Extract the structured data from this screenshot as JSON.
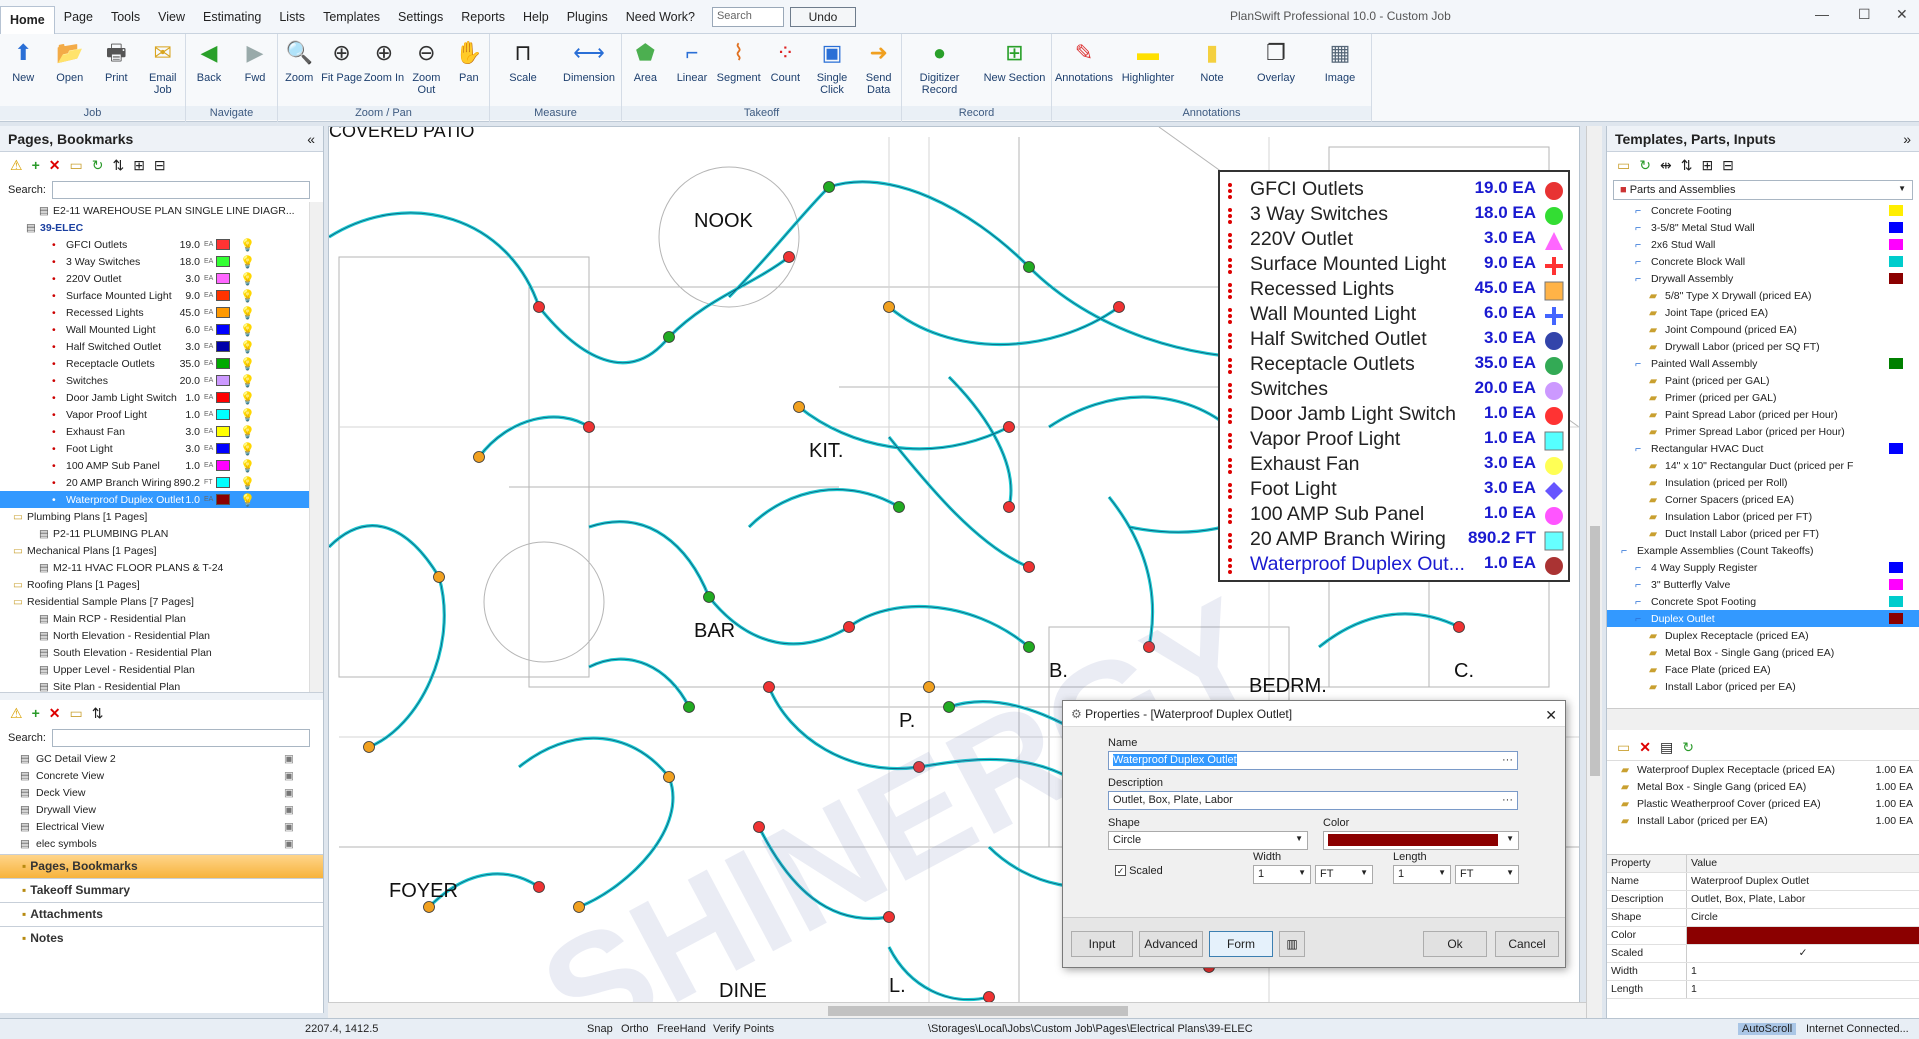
{
  "menu": {
    "tabs": [
      "Home",
      "Page",
      "Tools",
      "View",
      "Estimating",
      "Lists",
      "Templates",
      "Settings",
      "Reports",
      "Help",
      "Plugins",
      "Need Work?"
    ],
    "search_placeholder": "Search",
    "undo_label": "Undo",
    "app_title": "PlanSwift Professional 10.0 - Custom Job"
  },
  "ribbon": {
    "groups": [
      {
        "label": "Job",
        "buttons": [
          "New",
          "Open",
          "Print",
          "Email Job"
        ]
      },
      {
        "label": "Navigate",
        "buttons": [
          "Back",
          "Fwd"
        ]
      },
      {
        "label": "Zoom / Pan",
        "buttons": [
          "Zoom",
          "Fit Page",
          "Zoom In",
          "Zoom Out",
          "Pan"
        ]
      },
      {
        "label": "Measure",
        "buttons": [
          "Scale",
          "Dimension"
        ]
      },
      {
        "label": "Takeoff",
        "buttons": [
          "Area",
          "Linear",
          "Segment",
          "Count",
          "Single Click",
          "Send Data"
        ]
      },
      {
        "label": "Record",
        "buttons": [
          "Digitizer Record",
          "New Section"
        ]
      },
      {
        "label": "Annotations",
        "buttons": [
          "Annotations",
          "Highlighter",
          "Note",
          "Overlay",
          "Image"
        ]
      }
    ]
  },
  "left_panel": {
    "title": "Pages, Bookmarks",
    "search_label": "Search:",
    "tree": [
      {
        "label": "E2-11 WAREHOUSE PLAN SINGLE LINE DIAGR...",
        "indent": 3,
        "kind": "page"
      },
      {
        "label": "39-ELEC",
        "indent": 2,
        "kind": "page-bold"
      },
      {
        "label": "GFCI Outlets",
        "qty": "19.0",
        "unit": "EA",
        "color": "#ff3333",
        "indent": 4
      },
      {
        "label": "3 Way Switches",
        "qty": "18.0",
        "unit": "EA",
        "color": "#33ff33",
        "indent": 4
      },
      {
        "label": "220V Outlet",
        "qty": "3.0",
        "unit": "EA",
        "color": "#ff66ff",
        "indent": 4
      },
      {
        "label": "Surface Mounted Light",
        "qty": "9.0",
        "unit": "EA",
        "color": "#ff3300",
        "indent": 4
      },
      {
        "label": "Recessed Lights",
        "qty": "45.0",
        "unit": "EA",
        "color": "#ff9900",
        "indent": 4
      },
      {
        "label": "Wall Mounted Light",
        "qty": "6.0",
        "unit": "EA",
        "color": "#0000ff",
        "indent": 4
      },
      {
        "label": "Half Switched Outlet",
        "qty": "3.0",
        "unit": "EA",
        "color": "#0000aa",
        "indent": 4
      },
      {
        "label": "Receptacle Outlets",
        "qty": "35.0",
        "unit": "EA",
        "color": "#00aa00",
        "indent": 4
      },
      {
        "label": "Switches",
        "qty": "20.0",
        "unit": "EA",
        "color": "#cc99ff",
        "indent": 4
      },
      {
        "label": "Door Jamb Light Switch",
        "qty": "1.0",
        "unit": "EA",
        "color": "#ff0000",
        "indent": 4
      },
      {
        "label": "Vapor Proof Light",
        "qty": "1.0",
        "unit": "EA",
        "color": "#00ffff",
        "indent": 4
      },
      {
        "label": "Exhaust Fan",
        "qty": "3.0",
        "unit": "EA",
        "color": "#ffff00",
        "indent": 4
      },
      {
        "label": "Foot Light",
        "qty": "3.0",
        "unit": "EA",
        "color": "#0000ff",
        "indent": 4
      },
      {
        "label": "100 AMP Sub Panel",
        "qty": "1.0",
        "unit": "EA",
        "color": "#ff00ff",
        "indent": 4
      },
      {
        "label": "20 AMP Branch Wiring",
        "qty": "890.2",
        "unit": "FT",
        "color": "#00ffff",
        "indent": 4
      },
      {
        "label": "Waterproof Duplex Outlet",
        "qty": "1.0",
        "unit": "EA",
        "color": "#8b0000",
        "indent": 4,
        "selected": true
      },
      {
        "label": "Plumbing Plans [1 Pages]",
        "indent": 1,
        "kind": "folder"
      },
      {
        "label": "P2-11 PLUMBING PLAN",
        "indent": 3,
        "kind": "page"
      },
      {
        "label": "Mechanical Plans [1 Pages]",
        "indent": 1,
        "kind": "folder"
      },
      {
        "label": "M2-11 HVAC FLOOR PLANS & T-24",
        "indent": 3,
        "kind": "page"
      },
      {
        "label": "Roofing Plans [1 Pages]",
        "indent": 1,
        "kind": "folder"
      },
      {
        "label": "Residential Sample Plans [7 Pages]",
        "indent": 1,
        "kind": "folder"
      },
      {
        "label": "Main RCP - Residential Plan",
        "indent": 3,
        "kind": "page"
      },
      {
        "label": "North Elevation - Residential Plan",
        "indent": 3,
        "kind": "page"
      },
      {
        "label": "South Elevation - Residential Plan",
        "indent": 3,
        "kind": "page"
      },
      {
        "label": "Upper Level - Residential Plan",
        "indent": 3,
        "kind": "page"
      },
      {
        "label": "Site Plan - Residential Plan",
        "indent": 3,
        "kind": "page"
      }
    ],
    "bookmarks_search_label": "Search:",
    "bookmarks": [
      "GC Detail View 2",
      "Concrete View",
      "Deck View",
      "Drywall View",
      "Electrical View",
      "elec symbols"
    ],
    "nav_panes": [
      "Pages, Bookmarks",
      "Takeoff Summary",
      "Attachments",
      "Notes"
    ]
  },
  "drawing": {
    "room_labels": [
      "COVERED PATIO",
      "NOOK",
      "KIT.",
      "BAR",
      "FOYER",
      "DINE",
      "B.",
      "BEDRM.",
      "C.",
      "P.",
      "L."
    ]
  },
  "legend": {
    "rows": [
      {
        "name": "GFCI Outlets",
        "value": "19.0 EA",
        "color": "#e83333",
        "shape": "circle"
      },
      {
        "name": "3 Way Switches",
        "value": "18.0 EA",
        "color": "#33dd33",
        "shape": "circle"
      },
      {
        "name": "220V Outlet",
        "value": "3.0 EA",
        "color": "#ff66ff",
        "shape": "triangle"
      },
      {
        "name": "Surface Mounted Light",
        "value": "9.0 EA",
        "color": "#ff3333",
        "shape": "plus"
      },
      {
        "name": "Recessed Lights",
        "value": "45.0 EA",
        "color": "#ffb347",
        "shape": "square"
      },
      {
        "name": "Wall Mounted Light",
        "value": "6.0 EA",
        "color": "#4466ff",
        "shape": "plus"
      },
      {
        "name": "Half Switched Outlet",
        "value": "3.0 EA",
        "color": "#3344aa",
        "shape": "circle"
      },
      {
        "name": "Receptacle Outlets",
        "value": "35.0 EA",
        "color": "#33aa55",
        "shape": "circle"
      },
      {
        "name": "Switches",
        "value": "20.0 EA",
        "color": "#cc99ff",
        "shape": "circle"
      },
      {
        "name": "Door Jamb Light Switch",
        "value": "1.0 EA",
        "color": "#ff3333",
        "shape": "circle"
      },
      {
        "name": "Vapor Proof Light",
        "value": "1.0 EA",
        "color": "#55ffff",
        "shape": "square"
      },
      {
        "name": "Exhaust Fan",
        "value": "3.0 EA",
        "color": "#ffff55",
        "shape": "circle"
      },
      {
        "name": "Foot Light",
        "value": "3.0 EA",
        "color": "#6655ff",
        "shape": "diamond"
      },
      {
        "name": "100 AMP Sub Panel",
        "value": "1.0 EA",
        "color": "#ff55ff",
        "shape": "circle"
      },
      {
        "name": "20 AMP Branch Wiring",
        "value": "890.2 FT",
        "color": "#66ffff",
        "shape": "square"
      },
      {
        "name": "Waterproof Duplex Out...",
        "value": "1.0 EA",
        "color": "#aa3333",
        "shape": "circle"
      }
    ]
  },
  "dialog": {
    "title": "Properties - [Waterproof Duplex Outlet]",
    "name_label": "Name",
    "name_value": "Waterproof Duplex Outlet",
    "desc_label": "Description",
    "desc_value": "Outlet, Box, Plate, Labor",
    "shape_label": "Shape",
    "shape_value": "Circle",
    "color_label": "Color",
    "color_value": "#8b0000",
    "scaled_label": "Scaled",
    "width_label": "Width",
    "width_value": "1",
    "width_unit": "FT",
    "length_label": "Length",
    "length_value": "1",
    "length_unit": "FT",
    "buttons": [
      "Input",
      "Advanced",
      "Form",
      "Ok",
      "Cancel"
    ]
  },
  "right_panel": {
    "title": "Templates, Parts, Inputs",
    "dropdown": "Parts and Assemblies",
    "tree": [
      {
        "label": "Concrete Footing",
        "indent": 2,
        "color": "#ffee00"
      },
      {
        "label": "3-5/8\" Metal Stud Wall",
        "indent": 2,
        "color": "#0000ff"
      },
      {
        "label": "2x6 Stud Wall",
        "indent": 2,
        "color": "#ff00ff"
      },
      {
        "label": "Concrete Block Wall",
        "indent": 2,
        "color": "#00cccc"
      },
      {
        "label": "Drywall Assembly",
        "indent": 2,
        "color": "#8b0000"
      },
      {
        "label": "5/8\" Type X Drywall (priced EA)",
        "indent": 3
      },
      {
        "label": "Joint Tape (priced EA)",
        "indent": 3
      },
      {
        "label": "Joint Compound (priced EA)",
        "indent": 3
      },
      {
        "label": "Drywall Labor (priced per SQ FT)",
        "indent": 3
      },
      {
        "label": "Painted Wall Assembly",
        "indent": 2,
        "color": "#008000"
      },
      {
        "label": "Paint (priced per GAL)",
        "indent": 3
      },
      {
        "label": "Primer (priced per GAL)",
        "indent": 3
      },
      {
        "label": "Paint Spread Labor (priced per Hour)",
        "indent": 3
      },
      {
        "label": "Primer Spread Labor (priced per Hour)",
        "indent": 3
      },
      {
        "label": "Rectangular HVAC Duct",
        "indent": 2,
        "color": "#0000ff"
      },
      {
        "label": "14\" x 10\" Rectangular Duct (priced per F",
        "indent": 3
      },
      {
        "label": "Insulation (priced per Roll)",
        "indent": 3
      },
      {
        "label": "Corner Spacers (priced EA)",
        "indent": 3
      },
      {
        "label": "Insulation Labor (priced per FT)",
        "indent": 3
      },
      {
        "label": "Duct Install Labor (priced per FT)",
        "indent": 3
      },
      {
        "label": "Example Assemblies (Count Takeoffs)",
        "indent": 1
      },
      {
        "label": "4 Way Supply Register",
        "indent": 2,
        "color": "#0000ff"
      },
      {
        "label": "3\" Butterfly Valve",
        "indent": 2,
        "color": "#ff00ff"
      },
      {
        "label": "Concrete Spot Footing",
        "indent": 2,
        "color": "#00cccc"
      },
      {
        "label": "Duplex Outlet",
        "indent": 2,
        "color": "#8b0000",
        "selected": true
      },
      {
        "label": "Duplex Receptacle (priced EA)",
        "indent": 3
      },
      {
        "label": "Metal Box - Single Gang (priced EA)",
        "indent": 3
      },
      {
        "label": "Face Plate (priced EA)",
        "indent": 3
      },
      {
        "label": "Install Labor (priced per EA)",
        "indent": 3
      }
    ],
    "items": [
      {
        "label": "Waterproof Duplex Receptacle (priced EA)",
        "qty": "1.00 EA"
      },
      {
        "label": "Metal Box - Single Gang (priced EA)",
        "qty": "1.00 EA"
      },
      {
        "label": "Plastic Weatherproof Cover (priced EA)",
        "qty": "1.00 EA"
      },
      {
        "label": "Install Labor (priced per EA)",
        "qty": "1.00 EA"
      }
    ],
    "prop_header": {
      "k": "Property",
      "v": "Value"
    },
    "props": [
      {
        "k": "Name",
        "v": "Waterproof Duplex Outlet"
      },
      {
        "k": "Description",
        "v": "Outlet, Box, Plate, Labor"
      },
      {
        "k": "Shape",
        "v": "Circle"
      },
      {
        "k": "Color",
        "v": ""
      },
      {
        "k": "Scaled",
        "v": "✓"
      },
      {
        "k": "Width",
        "v": "1"
      },
      {
        "k": "Length",
        "v": "1"
      }
    ]
  },
  "status": {
    "coords": "2207.4, 1412.5",
    "snap": "Snap",
    "ortho": "Ortho",
    "freehand": "FreeHand",
    "verify": "Verify Points",
    "path": "\\Storages\\Local\\Jobs\\Custom Job\\Pages\\Electrical Plans\\39-ELEC",
    "autoscroll": "AutoScroll",
    "internet": "Internet Connected..."
  }
}
